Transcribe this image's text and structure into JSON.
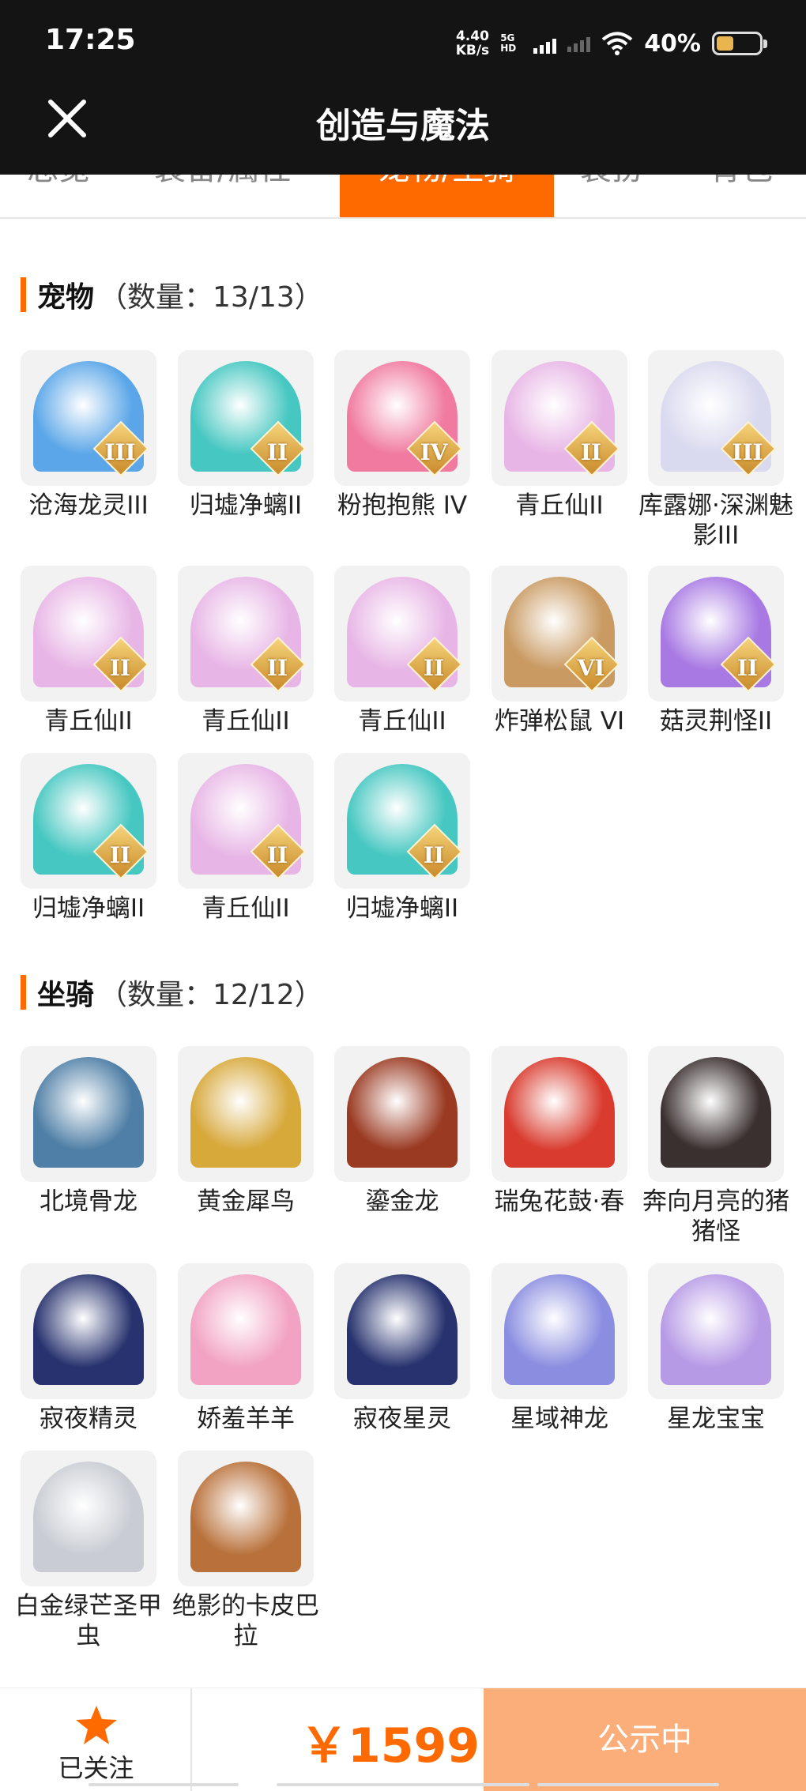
{
  "status": {
    "time": "17:25",
    "speed_value": "4.40",
    "speed_unit": "KB/s",
    "net_type": "5G HD",
    "battery_pct": "40%",
    "battery_fill": 0.4
  },
  "header": {
    "title": "创造与魔法"
  },
  "tabs": [
    {
      "label": "总览"
    },
    {
      "label": "装备/属性"
    },
    {
      "label": "宠物/坐骑"
    },
    {
      "label": "装扮"
    },
    {
      "label": "背包"
    }
  ],
  "pets": {
    "name": "宠物",
    "count": "（数量：13/13）",
    "items": [
      {
        "label": "沧海龙灵III",
        "badge": "III",
        "color": "#5aa6e8"
      },
      {
        "label": "归墟净螭II",
        "badge": "II",
        "color": "#46c7c1"
      },
      {
        "label": "粉抱抱熊 IV",
        "badge": "IV",
        "color": "#f07aa0"
      },
      {
        "label": "青丘仙II",
        "badge": "II",
        "color": "#e8b6e6"
      },
      {
        "label": "库露娜·深渊魅影III",
        "badge": "III",
        "color": "#d9d9ef"
      },
      {
        "label": "青丘仙II",
        "badge": "II",
        "color": "#e8b6e6"
      },
      {
        "label": "青丘仙II",
        "badge": "II",
        "color": "#e8b6e6"
      },
      {
        "label": "青丘仙II",
        "badge": "II",
        "color": "#e8b6e6"
      },
      {
        "label": "炸弹松鼠 VI",
        "badge": "VI",
        "color": "#c99a62"
      },
      {
        "label": "菇灵荆怪II",
        "badge": "II",
        "color": "#a879e3"
      },
      {
        "label": "归墟净螭II",
        "badge": "II",
        "color": "#46c7c1"
      },
      {
        "label": "青丘仙II",
        "badge": "II",
        "color": "#e8b6e6"
      },
      {
        "label": "归墟净螭II",
        "badge": "II",
        "color": "#46c7c1"
      }
    ]
  },
  "mounts": {
    "name": "坐骑",
    "count": "（数量：12/12）",
    "items": [
      {
        "label": "北境骨龙",
        "color": "#4f7fa6"
      },
      {
        "label": "黄金犀鸟",
        "color": "#d7a83a"
      },
      {
        "label": "鎏金龙",
        "color": "#9a3a22"
      },
      {
        "label": "瑞兔花鼓·春",
        "color": "#d93b2e"
      },
      {
        "label": "奔向月亮的猪猪怪",
        "color": "#3b3030"
      },
      {
        "label": "寂夜精灵",
        "color": "#27326e"
      },
      {
        "label": "娇羞羊羊",
        "color": "#f2a3c3"
      },
      {
        "label": "寂夜星灵",
        "color": "#27326e"
      },
      {
        "label": "星域神龙",
        "color": "#8a8de0"
      },
      {
        "label": "星龙宝宝",
        "color": "#b79ae6"
      },
      {
        "label": "白金绿芒圣甲虫",
        "color": "#c9cdd3"
      },
      {
        "label": "绝影的卡皮巴拉",
        "color": "#b9713b"
      }
    ]
  },
  "bottom": {
    "follow_label": "已关注",
    "price": "￥1599",
    "cta": "公示中"
  },
  "colors": {
    "accent": "#ff6a00",
    "cta_bg": "#fbad7a",
    "header_bg": "#141414"
  }
}
